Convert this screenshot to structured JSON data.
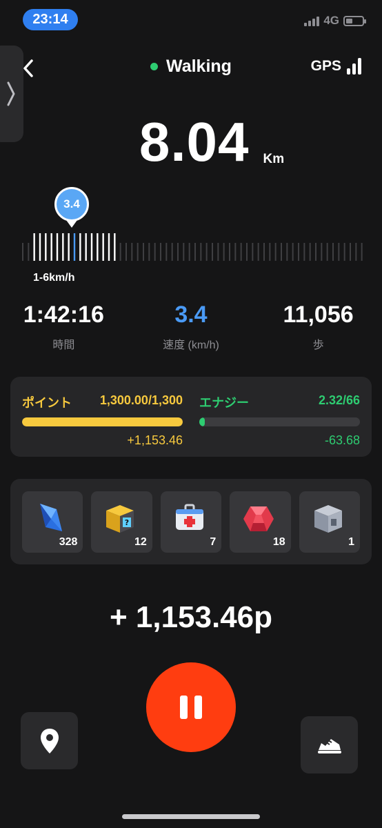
{
  "status_bar": {
    "time": "23:14",
    "network": "4G"
  },
  "header": {
    "activity": "Walking",
    "gps_label": "GPS"
  },
  "distance": {
    "value": "8.04",
    "unit": "Km"
  },
  "speed_slider": {
    "current": "3.4",
    "range_label": "1-6km/h"
  },
  "stats": [
    {
      "value": "1:42:16",
      "label": "時間"
    },
    {
      "value": "3.4",
      "label": "速度 (km/h)"
    },
    {
      "value": "11,056",
      "label": "歩"
    }
  ],
  "points": {
    "label": "ポイント",
    "value": "1,300.00/1,300",
    "fill": 1.0,
    "delta": "+1,153.46",
    "color": "#f7c93e"
  },
  "energy": {
    "label": "エナジー",
    "value": "2.32/66",
    "fill": 0.035,
    "delta": "-63.68",
    "color": "#2ecc71"
  },
  "items": [
    {
      "icon": "blue-crystal-icon",
      "count": "328"
    },
    {
      "icon": "mystery-box-icon",
      "count": "12"
    },
    {
      "icon": "first-aid-kit-icon",
      "count": "7"
    },
    {
      "icon": "red-gem-icon",
      "count": "18"
    },
    {
      "icon": "silver-box-icon",
      "count": "1"
    }
  ],
  "earned": "+ 1,153.46p",
  "colors": {
    "accent_blue": "#4a9af5",
    "pause_red": "#ff3d10"
  }
}
